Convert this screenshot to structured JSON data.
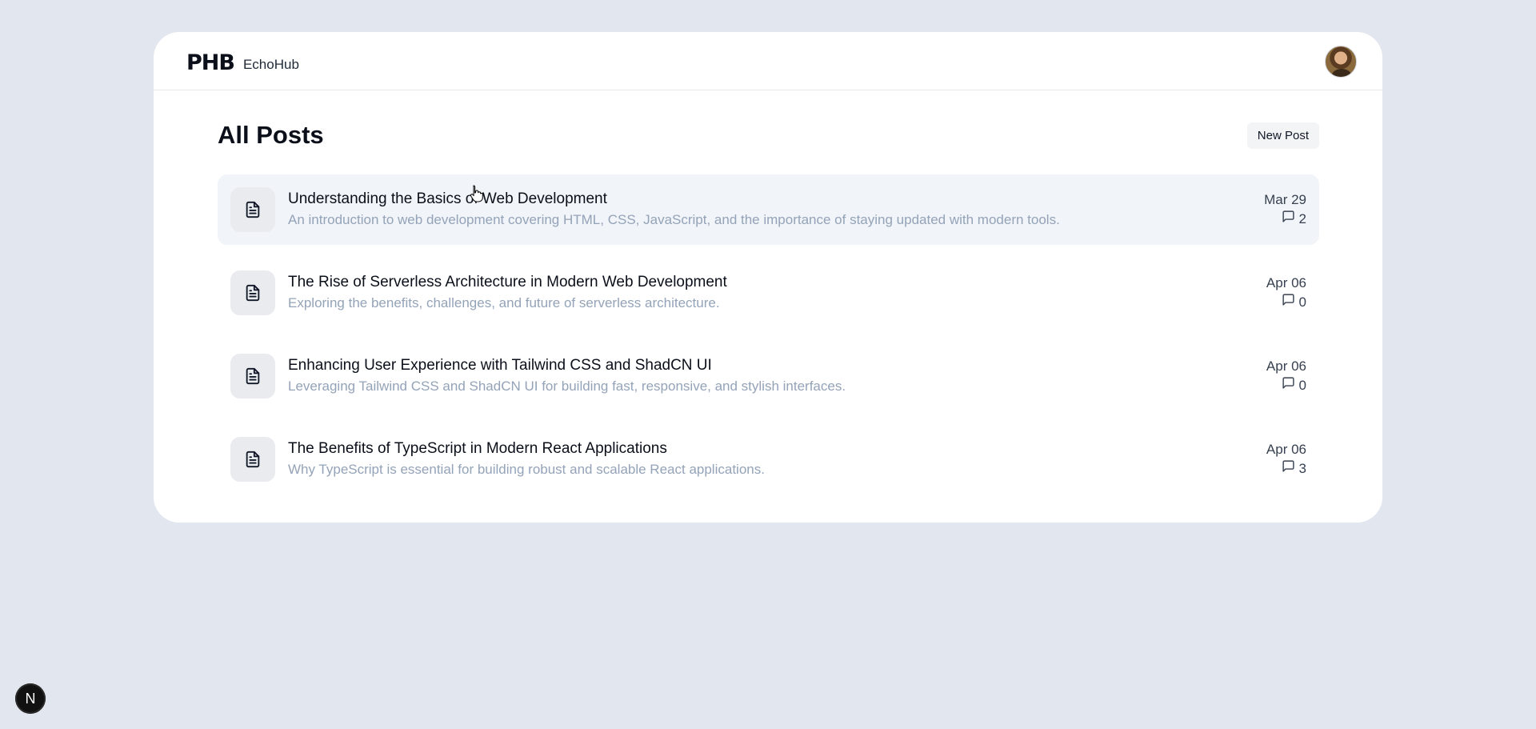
{
  "header": {
    "logo_text": "PHB",
    "app_name": "EchoHub",
    "avatar_icon": "user-avatar"
  },
  "main": {
    "title": "All Posts",
    "new_post_label": "New Post"
  },
  "posts": [
    {
      "title": "Understanding the Basics of Web Development",
      "description": "An introduction to web development covering HTML, CSS, JavaScript, and the importance of staying updated with modern tools.",
      "date": "Mar 29",
      "comments": "2"
    },
    {
      "title": "The Rise of Serverless Architecture in Modern Web Development",
      "description": "Exploring the benefits, challenges, and future of serverless architecture.",
      "date": "Apr 06",
      "comments": "0"
    },
    {
      "title": "Enhancing User Experience with Tailwind CSS and ShadCN UI",
      "description": "Leveraging Tailwind CSS and ShadCN UI for building fast, responsive, and stylish interfaces.",
      "date": "Apr 06",
      "comments": "0"
    },
    {
      "title": "The Benefits of TypeScript in Modern React Applications",
      "description": "Why TypeScript is essential for building robust and scalable React applications.",
      "date": "Apr 06",
      "comments": "3"
    }
  ],
  "dev_badge": {
    "label": "N"
  },
  "colors": {
    "background": "#e2e6ee",
    "card": "#ffffff",
    "hover_row": "#f1f4f8",
    "muted_text": "#94a3b8"
  }
}
